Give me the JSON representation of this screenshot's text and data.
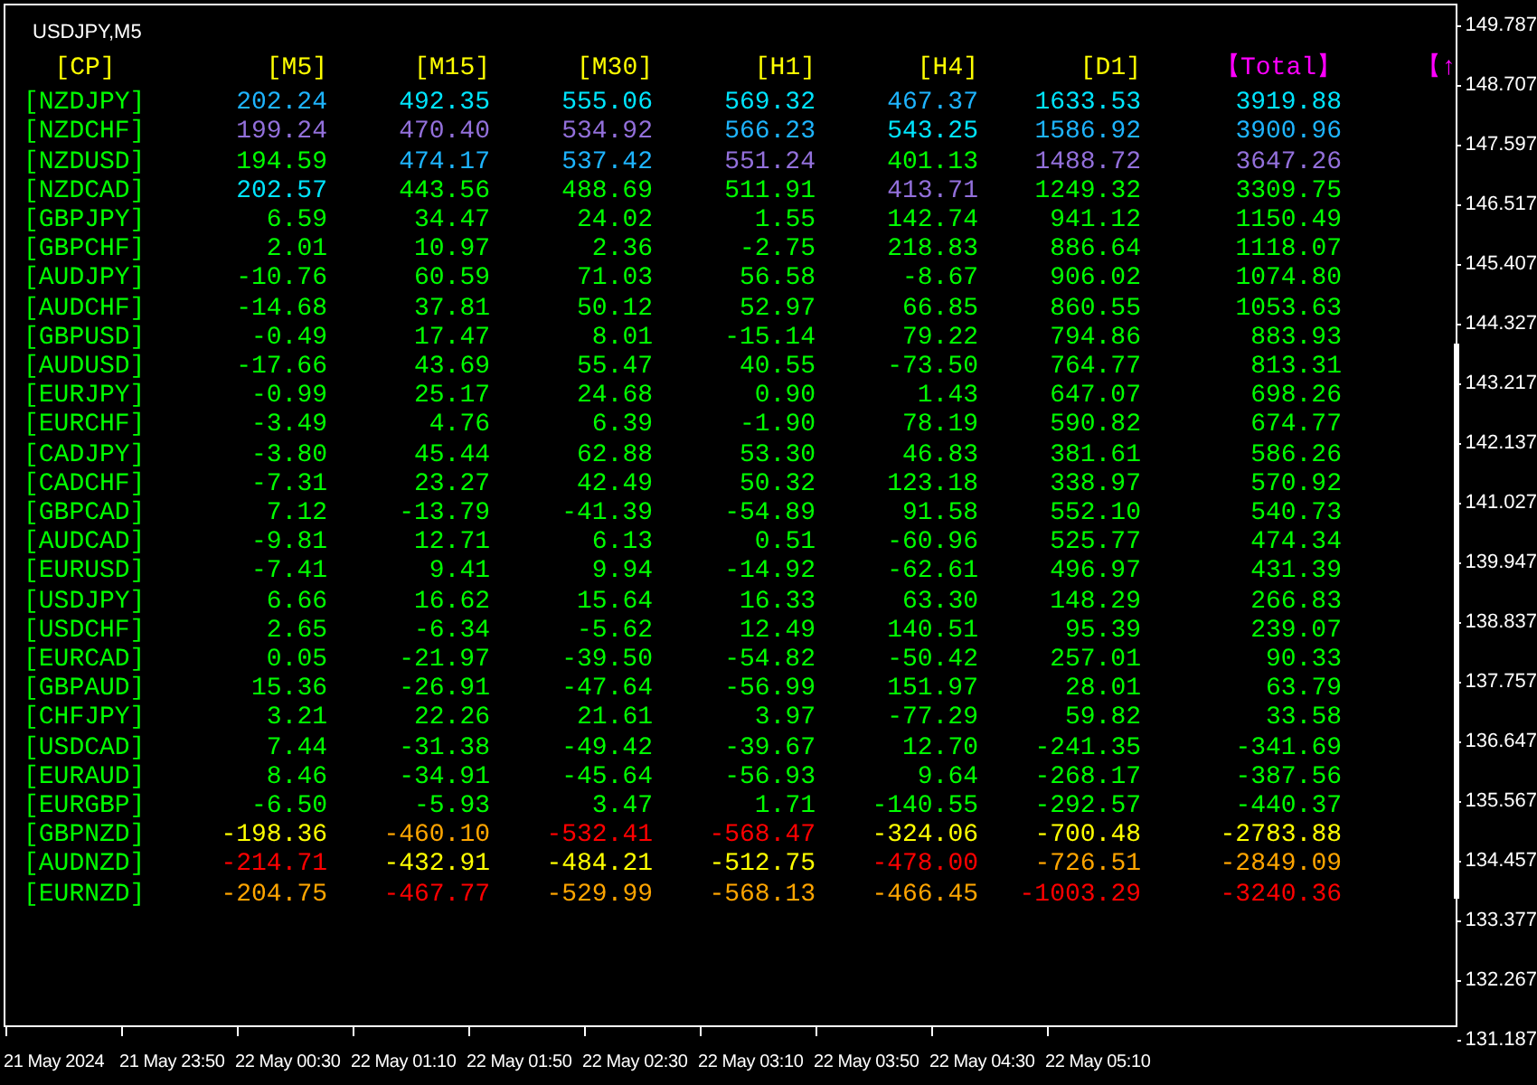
{
  "chart": {
    "title": "USDJPY,M5"
  },
  "table": {
    "columns": [
      {
        "label": "[CP]",
        "color": "#ffff00"
      },
      {
        "label": "[M5]",
        "color": "#ffff00"
      },
      {
        "label": "[M15]",
        "color": "#ffff00"
      },
      {
        "label": "[M30]",
        "color": "#ffff00"
      },
      {
        "label": "[H1]",
        "color": "#ffff00"
      },
      {
        "label": "[H4]",
        "color": "#ffff00"
      },
      {
        "label": "[D1]",
        "color": "#ffff00"
      },
      {
        "label": "【Total】",
        "color": "#ff00ff"
      },
      {
        "label": "【↑",
        "color": "#ff00ff"
      }
    ],
    "rows": [
      {
        "cells": [
          {
            "value": "[NZDJPY]"
          },
          {
            "value": "202.24",
            "color": "#1eb4ff"
          },
          {
            "value": "492.35",
            "color": "#00e5ff"
          },
          {
            "value": "555.06",
            "color": "#00e5ff"
          },
          {
            "value": "569.32",
            "color": "#00e5ff"
          },
          {
            "value": "467.37",
            "color": "#1eb4ff"
          },
          {
            "value": "1633.53",
            "color": "#00e5ff"
          },
          {
            "value": "3919.88",
            "color": "#00e5ff"
          }
        ]
      },
      {
        "cells": [
          {
            "value": "[NZDCHF]"
          },
          {
            "value": "199.24",
            "color": "#9370db"
          },
          {
            "value": "470.40",
            "color": "#9370db"
          },
          {
            "value": "534.92",
            "color": "#9370db"
          },
          {
            "value": "566.23",
            "color": "#1eb4ff"
          },
          {
            "value": "543.25",
            "color": "#00e5ff"
          },
          {
            "value": "1586.92",
            "color": "#1eb4ff"
          },
          {
            "value": "3900.96",
            "color": "#1eb4ff"
          }
        ]
      },
      {
        "cells": [
          {
            "value": "[NZDUSD]"
          },
          {
            "value": "194.59",
            "color": "#00ff00"
          },
          {
            "value": "474.17",
            "color": "#1eb4ff"
          },
          {
            "value": "537.42",
            "color": "#1eb4ff"
          },
          {
            "value": "551.24",
            "color": "#9370db"
          },
          {
            "value": "401.13",
            "color": "#00ff00"
          },
          {
            "value": "1488.72",
            "color": "#9370db"
          },
          {
            "value": "3647.26",
            "color": "#9370db"
          }
        ]
      },
      {
        "cells": [
          {
            "value": "[NZDCAD]"
          },
          {
            "value": "202.57",
            "color": "#00e5ff"
          },
          {
            "value": "443.56",
            "color": "#00ff00"
          },
          {
            "value": "488.69",
            "color": "#00ff00"
          },
          {
            "value": "511.91",
            "color": "#00ff00"
          },
          {
            "value": "413.71",
            "color": "#9370db"
          },
          {
            "value": "1249.32",
            "color": "#00ff00"
          },
          {
            "value": "3309.75",
            "color": "#00ff00"
          }
        ]
      },
      {
        "cells": [
          {
            "value": "[GBPJPY]"
          },
          {
            "value": "6.59",
            "color": "#00ff00"
          },
          {
            "value": "34.47",
            "color": "#00ff00"
          },
          {
            "value": "24.02",
            "color": "#00ff00"
          },
          {
            "value": "1.55",
            "color": "#00ff00"
          },
          {
            "value": "142.74",
            "color": "#00ff00"
          },
          {
            "value": "941.12",
            "color": "#00ff00"
          },
          {
            "value": "1150.49",
            "color": "#00ff00"
          }
        ]
      },
      {
        "cells": [
          {
            "value": "[GBPCHF]"
          },
          {
            "value": "2.01",
            "color": "#00ff00"
          },
          {
            "value": "10.97",
            "color": "#00ff00"
          },
          {
            "value": "2.36",
            "color": "#00ff00"
          },
          {
            "value": "-2.75",
            "color": "#00ff00"
          },
          {
            "value": "218.83",
            "color": "#00ff00"
          },
          {
            "value": "886.64",
            "color": "#00ff00"
          },
          {
            "value": "1118.07",
            "color": "#00ff00"
          }
        ]
      },
      {
        "cells": [
          {
            "value": "[AUDJPY]"
          },
          {
            "value": "-10.76",
            "color": "#00ff00"
          },
          {
            "value": "60.59",
            "color": "#00ff00"
          },
          {
            "value": "71.03",
            "color": "#00ff00"
          },
          {
            "value": "56.58",
            "color": "#00ff00"
          },
          {
            "value": "-8.67",
            "color": "#00ff00"
          },
          {
            "value": "906.02",
            "color": "#00ff00"
          },
          {
            "value": "1074.80",
            "color": "#00ff00"
          }
        ]
      },
      {
        "cells": [
          {
            "value": "[AUDCHF]"
          },
          {
            "value": "-14.68",
            "color": "#00ff00"
          },
          {
            "value": "37.81",
            "color": "#00ff00"
          },
          {
            "value": "50.12",
            "color": "#00ff00"
          },
          {
            "value": "52.97",
            "color": "#00ff00"
          },
          {
            "value": "66.85",
            "color": "#00ff00"
          },
          {
            "value": "860.55",
            "color": "#00ff00"
          },
          {
            "value": "1053.63",
            "color": "#00ff00"
          }
        ]
      },
      {
        "cells": [
          {
            "value": "[GBPUSD]"
          },
          {
            "value": "-0.49",
            "color": "#00ff00"
          },
          {
            "value": "17.47",
            "color": "#00ff00"
          },
          {
            "value": "8.01",
            "color": "#00ff00"
          },
          {
            "value": "-15.14",
            "color": "#00ff00"
          },
          {
            "value": "79.22",
            "color": "#00ff00"
          },
          {
            "value": "794.86",
            "color": "#00ff00"
          },
          {
            "value": "883.93",
            "color": "#00ff00"
          }
        ]
      },
      {
        "cells": [
          {
            "value": "[AUDUSD]"
          },
          {
            "value": "-17.66",
            "color": "#00ff00"
          },
          {
            "value": "43.69",
            "color": "#00ff00"
          },
          {
            "value": "55.47",
            "color": "#00ff00"
          },
          {
            "value": "40.55",
            "color": "#00ff00"
          },
          {
            "value": "-73.50",
            "color": "#00ff00"
          },
          {
            "value": "764.77",
            "color": "#00ff00"
          },
          {
            "value": "813.31",
            "color": "#00ff00"
          }
        ]
      },
      {
        "cells": [
          {
            "value": "[EURJPY]"
          },
          {
            "value": "-0.99",
            "color": "#00ff00"
          },
          {
            "value": "25.17",
            "color": "#00ff00"
          },
          {
            "value": "24.68",
            "color": "#00ff00"
          },
          {
            "value": "0.90",
            "color": "#00ff00"
          },
          {
            "value": "1.43",
            "color": "#00ff00"
          },
          {
            "value": "647.07",
            "color": "#00ff00"
          },
          {
            "value": "698.26",
            "color": "#00ff00"
          }
        ]
      },
      {
        "cells": [
          {
            "value": "[EURCHF]"
          },
          {
            "value": "-3.49",
            "color": "#00ff00"
          },
          {
            "value": "4.76",
            "color": "#00ff00"
          },
          {
            "value": "6.39",
            "color": "#00ff00"
          },
          {
            "value": "-1.90",
            "color": "#00ff00"
          },
          {
            "value": "78.19",
            "color": "#00ff00"
          },
          {
            "value": "590.82",
            "color": "#00ff00"
          },
          {
            "value": "674.77",
            "color": "#00ff00"
          }
        ]
      },
      {
        "cells": [
          {
            "value": "[CADJPY]"
          },
          {
            "value": "-3.80",
            "color": "#00ff00"
          },
          {
            "value": "45.44",
            "color": "#00ff00"
          },
          {
            "value": "62.88",
            "color": "#00ff00"
          },
          {
            "value": "53.30",
            "color": "#00ff00"
          },
          {
            "value": "46.83",
            "color": "#00ff00"
          },
          {
            "value": "381.61",
            "color": "#00ff00"
          },
          {
            "value": "586.26",
            "color": "#00ff00"
          }
        ]
      },
      {
        "cells": [
          {
            "value": "[CADCHF]"
          },
          {
            "value": "-7.31",
            "color": "#00ff00"
          },
          {
            "value": "23.27",
            "color": "#00ff00"
          },
          {
            "value": "42.49",
            "color": "#00ff00"
          },
          {
            "value": "50.32",
            "color": "#00ff00"
          },
          {
            "value": "123.18",
            "color": "#00ff00"
          },
          {
            "value": "338.97",
            "color": "#00ff00"
          },
          {
            "value": "570.92",
            "color": "#00ff00"
          }
        ]
      },
      {
        "cells": [
          {
            "value": "[GBPCAD]"
          },
          {
            "value": "7.12",
            "color": "#00ff00"
          },
          {
            "value": "-13.79",
            "color": "#00ff00"
          },
          {
            "value": "-41.39",
            "color": "#00ff00"
          },
          {
            "value": "-54.89",
            "color": "#00ff00"
          },
          {
            "value": "91.58",
            "color": "#00ff00"
          },
          {
            "value": "552.10",
            "color": "#00ff00"
          },
          {
            "value": "540.73",
            "color": "#00ff00"
          }
        ]
      },
      {
        "cells": [
          {
            "value": "[AUDCAD]"
          },
          {
            "value": "-9.81",
            "color": "#00ff00"
          },
          {
            "value": "12.71",
            "color": "#00ff00"
          },
          {
            "value": "6.13",
            "color": "#00ff00"
          },
          {
            "value": "0.51",
            "color": "#00ff00"
          },
          {
            "value": "-60.96",
            "color": "#00ff00"
          },
          {
            "value": "525.77",
            "color": "#00ff00"
          },
          {
            "value": "474.34",
            "color": "#00ff00"
          }
        ]
      },
      {
        "cells": [
          {
            "value": "[EURUSD]"
          },
          {
            "value": "-7.41",
            "color": "#00ff00"
          },
          {
            "value": "9.41",
            "color": "#00ff00"
          },
          {
            "value": "9.94",
            "color": "#00ff00"
          },
          {
            "value": "-14.92",
            "color": "#00ff00"
          },
          {
            "value": "-62.61",
            "color": "#00ff00"
          },
          {
            "value": "496.97",
            "color": "#00ff00"
          },
          {
            "value": "431.39",
            "color": "#00ff00"
          }
        ]
      },
      {
        "cells": [
          {
            "value": "[USDJPY]"
          },
          {
            "value": "6.66",
            "color": "#00ff00"
          },
          {
            "value": "16.62",
            "color": "#00ff00"
          },
          {
            "value": "15.64",
            "color": "#00ff00"
          },
          {
            "value": "16.33",
            "color": "#00ff00"
          },
          {
            "value": "63.30",
            "color": "#00ff00"
          },
          {
            "value": "148.29",
            "color": "#00ff00"
          },
          {
            "value": "266.83",
            "color": "#00ff00"
          }
        ]
      },
      {
        "cells": [
          {
            "value": "[USDCHF]"
          },
          {
            "value": "2.65",
            "color": "#00ff00"
          },
          {
            "value": "-6.34",
            "color": "#00ff00"
          },
          {
            "value": "-5.62",
            "color": "#00ff00"
          },
          {
            "value": "12.49",
            "color": "#00ff00"
          },
          {
            "value": "140.51",
            "color": "#00ff00"
          },
          {
            "value": "95.39",
            "color": "#00ff00"
          },
          {
            "value": "239.07",
            "color": "#00ff00"
          }
        ]
      },
      {
        "cells": [
          {
            "value": "[EURCAD]"
          },
          {
            "value": "0.05",
            "color": "#00ff00"
          },
          {
            "value": "-21.97",
            "color": "#00ff00"
          },
          {
            "value": "-39.50",
            "color": "#00ff00"
          },
          {
            "value": "-54.82",
            "color": "#00ff00"
          },
          {
            "value": "-50.42",
            "color": "#00ff00"
          },
          {
            "value": "257.01",
            "color": "#00ff00"
          },
          {
            "value": "90.33",
            "color": "#00ff00"
          }
        ]
      },
      {
        "cells": [
          {
            "value": "[GBPAUD]"
          },
          {
            "value": "15.36",
            "color": "#00ff00"
          },
          {
            "value": "-26.91",
            "color": "#00ff00"
          },
          {
            "value": "-47.64",
            "color": "#00ff00"
          },
          {
            "value": "-56.99",
            "color": "#00ff00"
          },
          {
            "value": "151.97",
            "color": "#00ff00"
          },
          {
            "value": "28.01",
            "color": "#00ff00"
          },
          {
            "value": "63.79",
            "color": "#00ff00"
          }
        ]
      },
      {
        "cells": [
          {
            "value": "[CHFJPY]"
          },
          {
            "value": "3.21",
            "color": "#00ff00"
          },
          {
            "value": "22.26",
            "color": "#00ff00"
          },
          {
            "value": "21.61",
            "color": "#00ff00"
          },
          {
            "value": "3.97",
            "color": "#00ff00"
          },
          {
            "value": "-77.29",
            "color": "#00ff00"
          },
          {
            "value": "59.82",
            "color": "#00ff00"
          },
          {
            "value": "33.58",
            "color": "#00ff00"
          }
        ]
      },
      {
        "cells": [
          {
            "value": "[USDCAD]"
          },
          {
            "value": "7.44",
            "color": "#00ff00"
          },
          {
            "value": "-31.38",
            "color": "#00ff00"
          },
          {
            "value": "-49.42",
            "color": "#00ff00"
          },
          {
            "value": "-39.67",
            "color": "#00ff00"
          },
          {
            "value": "12.70",
            "color": "#00ff00"
          },
          {
            "value": "-241.35",
            "color": "#00ff00"
          },
          {
            "value": "-341.69",
            "color": "#00ff00"
          }
        ]
      },
      {
        "cells": [
          {
            "value": "[EURAUD]"
          },
          {
            "value": "8.46",
            "color": "#00ff00"
          },
          {
            "value": "-34.91",
            "color": "#00ff00"
          },
          {
            "value": "-45.64",
            "color": "#00ff00"
          },
          {
            "value": "-56.93",
            "color": "#00ff00"
          },
          {
            "value": "9.64",
            "color": "#00ff00"
          },
          {
            "value": "-268.17",
            "color": "#00ff00"
          },
          {
            "value": "-387.56",
            "color": "#00ff00"
          }
        ]
      },
      {
        "cells": [
          {
            "value": "[EURGBP]"
          },
          {
            "value": "-6.50",
            "color": "#00ff00"
          },
          {
            "value": "-5.93",
            "color": "#00ff00"
          },
          {
            "value": "3.47",
            "color": "#00ff00"
          },
          {
            "value": "1.71",
            "color": "#00ff00"
          },
          {
            "value": "-140.55",
            "color": "#00ff00"
          },
          {
            "value": "-292.57",
            "color": "#00ff00"
          },
          {
            "value": "-440.37",
            "color": "#00ff00"
          }
        ]
      },
      {
        "cells": [
          {
            "value": "[GBPNZD]"
          },
          {
            "value": "-198.36",
            "color": "#ffff00"
          },
          {
            "value": "-460.10",
            "color": "#ffa500"
          },
          {
            "value": "-532.41",
            "color": "#ff0000"
          },
          {
            "value": "-568.47",
            "color": "#ff0000"
          },
          {
            "value": "-324.06",
            "color": "#ffff00"
          },
          {
            "value": "-700.48",
            "color": "#ffff00"
          },
          {
            "value": "-2783.88",
            "color": "#ffff00"
          }
        ]
      },
      {
        "cells": [
          {
            "value": "[AUDNZD]"
          },
          {
            "value": "-214.71",
            "color": "#ff0000"
          },
          {
            "value": "-432.91",
            "color": "#ffff00"
          },
          {
            "value": "-484.21",
            "color": "#ffff00"
          },
          {
            "value": "-512.75",
            "color": "#ffff00"
          },
          {
            "value": "-478.00",
            "color": "#ff0000"
          },
          {
            "value": "-726.51",
            "color": "#ffa500"
          },
          {
            "value": "-2849.09",
            "color": "#ffa500"
          }
        ]
      },
      {
        "cells": [
          {
            "value": "[EURNZD]"
          },
          {
            "value": "-204.75",
            "color": "#ffa500"
          },
          {
            "value": "-467.77",
            "color": "#ff0000"
          },
          {
            "value": "-529.99",
            "color": "#ffa500"
          },
          {
            "value": "-568.13",
            "color": "#ffa500"
          },
          {
            "value": "-466.45",
            "color": "#ffa500"
          },
          {
            "value": "-1003.29",
            "color": "#ff0000"
          },
          {
            "value": "-3240.36",
            "color": "#ff0000"
          }
        ]
      }
    ]
  },
  "price_axis": {
    "labels": [
      "149.787",
      "148.707",
      "147.597",
      "146.517",
      "145.407",
      "144.327",
      "143.217",
      "142.137",
      "141.027",
      "139.947",
      "138.837",
      "137.757",
      "136.647",
      "135.567",
      "134.457",
      "133.377",
      "132.267",
      "131.187"
    ]
  },
  "time_axis": {
    "labels": [
      "21 May 2024",
      "21 May 23:50",
      "22 May 00:30",
      "22 May 01:10",
      "22 May 01:50",
      "22 May 02:30",
      "22 May 03:10",
      "22 May 03:50",
      "22 May 04:30",
      "22 May 05:10"
    ]
  }
}
